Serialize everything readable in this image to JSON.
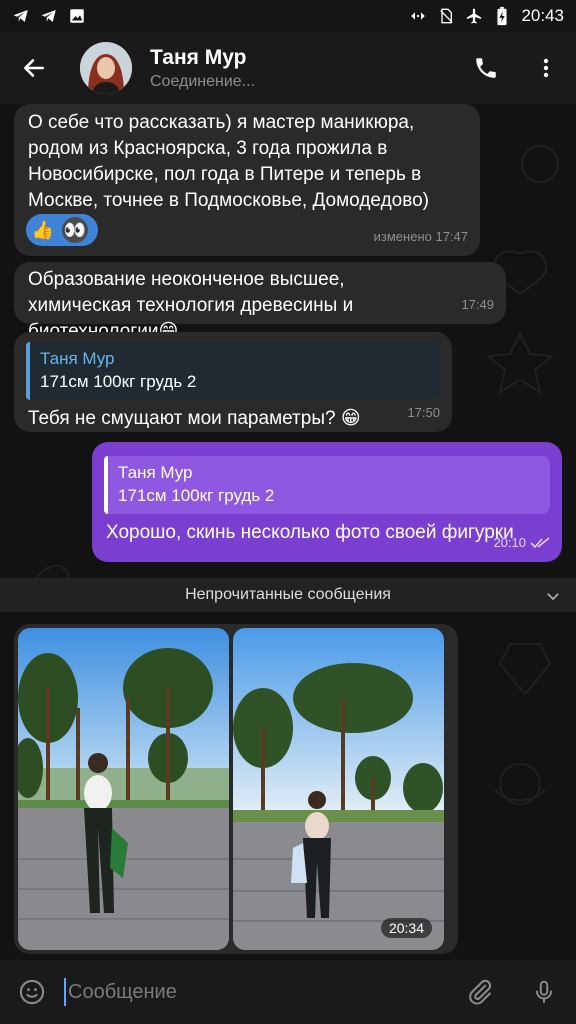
{
  "status_bar": {
    "time": "20:43"
  },
  "header": {
    "title": "Таня Мур",
    "subtitle": "Соединение..."
  },
  "messages": [
    {
      "text": "О себе что рассказать) я мастер маникюра, родом из Красноярска, 3 года прожила в Новосибирске, пол года в Питере и теперь в Москве, точнее в Подмосковье, Домодедово)",
      "time": "изменено 17:47",
      "reactions": [
        "👍",
        "👀"
      ]
    },
    {
      "text": "Образование неоконченое высшее, химическая технология древесины и биотехнологии😁",
      "time": "17:49"
    },
    {
      "reply_name": "Таня Мур",
      "reply_text": "171см 100кг грудь 2",
      "text": "Тебя не смущают мои параметры? 😁",
      "time": "17:50"
    },
    {
      "reply_name": "Таня Мур",
      "reply_text": "171см 100кг грудь 2",
      "text": "Хорошо, скинь несколько фото своей фигурки",
      "time": "20:10"
    }
  ],
  "unread_label": "Непрочитанные сообщения",
  "photo_message": {
    "time": "20:34"
  },
  "input": {
    "placeholder": "Сообщение"
  },
  "colors": {
    "outgoing": "#7a3fd0",
    "incoming": "#2a2a2a",
    "accent": "#5ea6ff"
  }
}
